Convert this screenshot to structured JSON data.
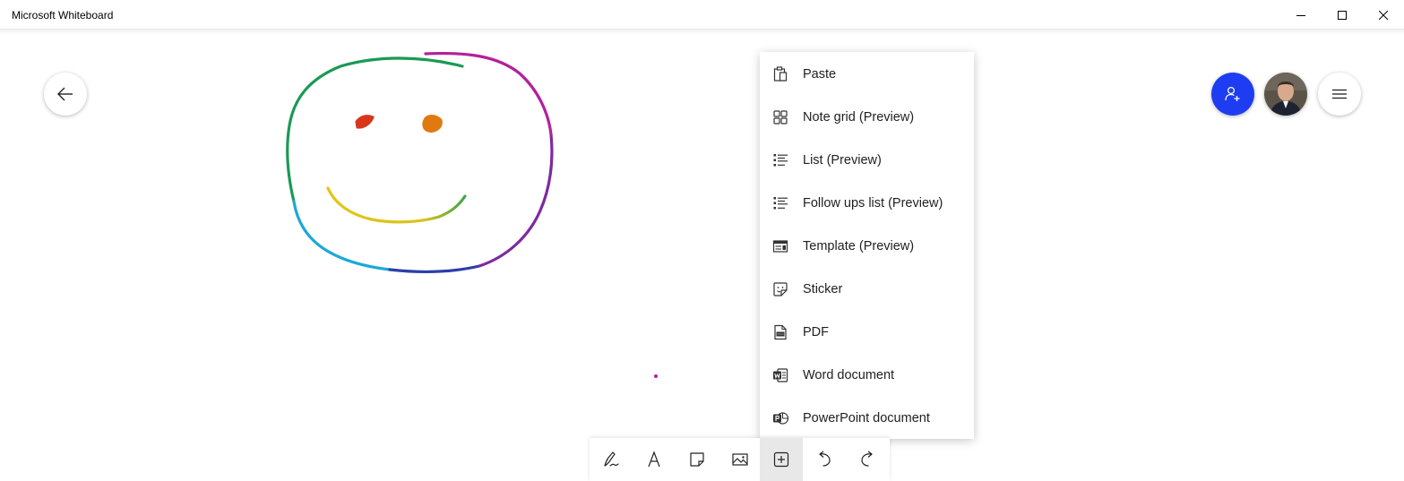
{
  "window": {
    "title": "Microsoft Whiteboard",
    "controls": [
      "minimize",
      "maximize",
      "close"
    ]
  },
  "header_buttons": {
    "back": "arrow-left-icon",
    "share": "add-person-icon",
    "avatar": "user-avatar",
    "menu": "hamburger-icon"
  },
  "colors": {
    "share_button": "#1e3df2",
    "stroke_green": "#1a9a55",
    "stroke_magenta": "#b3219a",
    "stroke_purple": "#7d2aa0",
    "stroke_blue": "#2a3fa8",
    "stroke_cyan": "#1da8d8",
    "stroke_yellow": "#e3c416",
    "stroke_orange": "#e07a10",
    "stroke_red": "#d8361a"
  },
  "context_menu": {
    "items": [
      {
        "label": "Paste",
        "icon": "paste-icon"
      },
      {
        "label": "Note grid (Preview)",
        "icon": "note-grid-icon"
      },
      {
        "label": "List (Preview)",
        "icon": "list-icon"
      },
      {
        "label": "Follow ups list (Preview)",
        "icon": "follow-ups-list-icon"
      },
      {
        "label": "Template (Preview)",
        "icon": "template-icon"
      },
      {
        "label": "Sticker",
        "icon": "sticker-icon"
      },
      {
        "label": "PDF",
        "icon": "pdf-icon"
      },
      {
        "label": "Word document",
        "icon": "word-icon"
      },
      {
        "label": "PowerPoint document",
        "icon": "powerpoint-icon"
      }
    ]
  },
  "toolbar": {
    "tools": [
      "pen-icon",
      "text-icon",
      "note-icon",
      "image-icon",
      "insert-icon",
      "undo-icon",
      "redo-icon"
    ],
    "active": "insert-icon"
  }
}
